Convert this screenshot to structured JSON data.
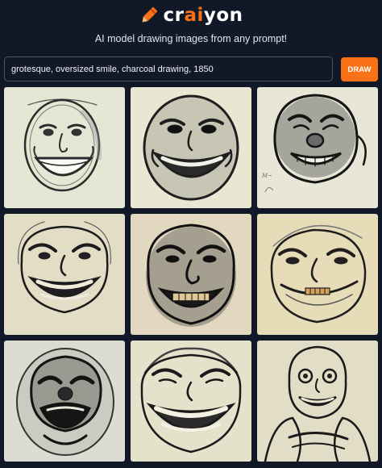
{
  "brand": {
    "logo_prefix": "cr",
    "logo_accent": "ai",
    "logo_suffix": "yon",
    "accent_color": "#f97316"
  },
  "tagline": "AI model drawing images from any prompt!",
  "search": {
    "value": "grotesque, oversized smile, charcoal drawing, 1850",
    "button_label": "DRAW"
  },
  "results": [
    {
      "paper": "#e6e6d4"
    },
    {
      "paper": "#e9e7d2"
    },
    {
      "paper": "#e8e7d7"
    },
    {
      "paper": "#e4ddc6"
    },
    {
      "paper": "#e1d8bf"
    },
    {
      "paper": "#e6dcb8"
    },
    {
      "paper": "#dcdcd2"
    },
    {
      "paper": "#e5e2cc"
    },
    {
      "paper": "#e2ddc6"
    }
  ]
}
